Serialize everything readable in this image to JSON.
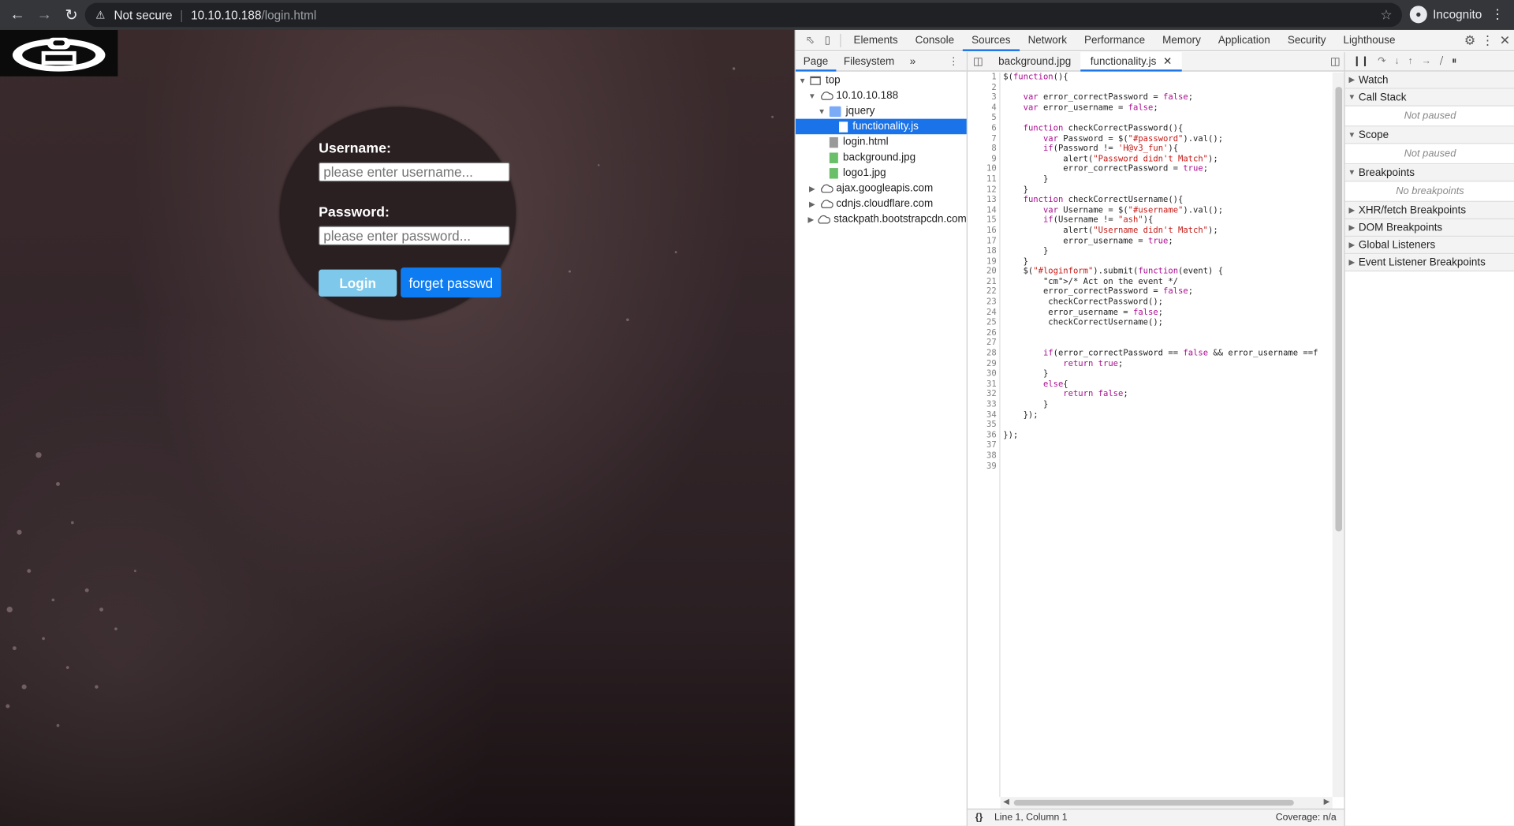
{
  "browser": {
    "security_label": "Not secure",
    "url_host": "10.10.10.188",
    "url_path": "/login.html",
    "profile_label": "Incognito"
  },
  "login_page": {
    "username_label": "Username:",
    "username_placeholder": "please enter username...",
    "password_label": "Password:",
    "password_placeholder": "please enter password...",
    "login_button": "Login",
    "forget_button": "forget passwd"
  },
  "devtools": {
    "tabs": [
      "Elements",
      "Console",
      "Sources",
      "Network",
      "Performance",
      "Memory",
      "Application",
      "Security",
      "Lighthouse"
    ],
    "active_tab": "Sources",
    "navigator_tabs": [
      "Page",
      "Filesystem"
    ],
    "tree": {
      "top": "top",
      "host": "10.10.10.188",
      "folder": "jquery",
      "selected_file": "functionality.js",
      "files": [
        "login.html",
        "background.jpg",
        "logo1.jpg"
      ],
      "domains": [
        "ajax.googleapis.com",
        "cdnjs.cloudflare.com",
        "stackpath.bootstrapcdn.com"
      ]
    },
    "editor_tabs": [
      "background.jpg",
      "functionality.js"
    ],
    "code_lines": [
      "$(function(){",
      "",
      "    var error_correctPassword = false;",
      "    var error_username = false;",
      "",
      "    function checkCorrectPassword(){",
      "        var Password = $(\"#password\").val();",
      "        if(Password != 'H@v3_fun'){",
      "            alert(\"Password didn't Match\");",
      "            error_correctPassword = true;",
      "        }",
      "    }",
      "    function checkCorrectUsername(){",
      "        var Username = $(\"#username\").val();",
      "        if(Username != \"ash\"){",
      "            alert(\"Username didn't Match\");",
      "            error_username = true;",
      "        }",
      "    }",
      "    $(\"#loginform\").submit(function(event) {",
      "        /* Act on the event */",
      "        error_correctPassword = false;",
      "         checkCorrectPassword();",
      "         error_username = false;",
      "         checkCorrectUsername();",
      "",
      "",
      "        if(error_correctPassword == false && error_username ==f",
      "            return true;",
      "        }",
      "        else{",
      "            return false;",
      "        }",
      "    });",
      "",
      "});",
      "",
      "",
      ""
    ],
    "status": {
      "braces": "{}",
      "cursor": "Line 1, Column 1",
      "coverage": "Coverage: n/a"
    },
    "debug_sections": [
      {
        "title": "Watch",
        "expanded": false,
        "body": ""
      },
      {
        "title": "Call Stack",
        "expanded": true,
        "body": "Not paused"
      },
      {
        "title": "Scope",
        "expanded": true,
        "body": "Not paused"
      },
      {
        "title": "Breakpoints",
        "expanded": true,
        "body": "No breakpoints"
      },
      {
        "title": "XHR/fetch Breakpoints",
        "expanded": false,
        "body": ""
      },
      {
        "title": "DOM Breakpoints",
        "expanded": false,
        "body": ""
      },
      {
        "title": "Global Listeners",
        "expanded": false,
        "body": ""
      },
      {
        "title": "Event Listener Breakpoints",
        "expanded": false,
        "body": ""
      }
    ]
  }
}
